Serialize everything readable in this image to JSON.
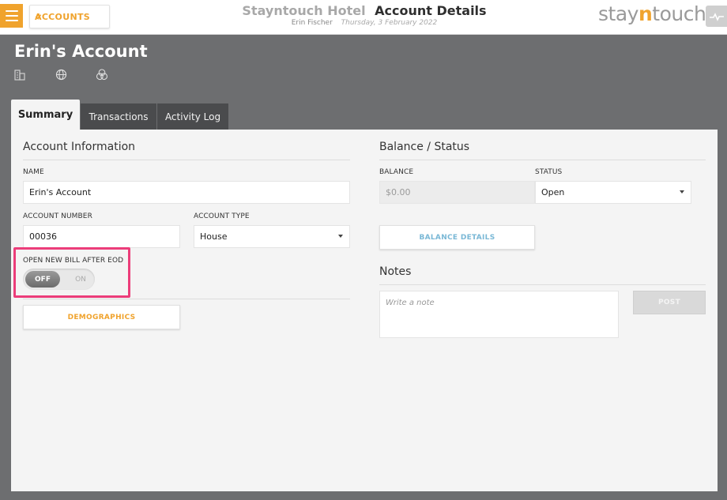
{
  "topbar": {
    "back_label": "ACCOUNTS",
    "hotel_name": "Stayntouch Hotel",
    "page_title": "Account Details",
    "user_name": "Erin Fischer",
    "date": "Thursday, 3 February 2022",
    "logo": {
      "prefix": "stay",
      "accent": "n",
      "suffix": "touch"
    }
  },
  "account": {
    "title": "Erin's Account",
    "icons": [
      "building-icon",
      "globe-icon",
      "venn-circles-icon"
    ]
  },
  "tabs": [
    {
      "label": "Summary",
      "active": true
    },
    {
      "label": "Transactions",
      "active": false
    },
    {
      "label": "Activity Log",
      "active": false
    }
  ],
  "account_info": {
    "section_title": "Account Information",
    "name_label": "NAME",
    "name_value": "Erin's Account",
    "number_label": "ACCOUNT NUMBER",
    "number_value": "00036",
    "type_label": "ACCOUNT TYPE",
    "type_value": "House",
    "open_bill_label": "OPEN NEW BILL AFTER EOD",
    "toggle_off": "OFF",
    "toggle_on": "ON",
    "toggle_state": "off",
    "demographics_button": "DEMOGRAPHICS"
  },
  "balance_status": {
    "section_title": "Balance / Status",
    "balance_label": "BALANCE",
    "balance_value": "$0.00",
    "status_label": "STATUS",
    "status_value": "Open",
    "details_button": "BALANCE DETAILS"
  },
  "notes": {
    "section_title": "Notes",
    "placeholder": "Write a note",
    "post_button": "POST"
  },
  "colors": {
    "accent": "#f0a32d",
    "link_blue": "#7ab8d6",
    "highlight": "#ec3d7a",
    "background": "#6d6e70"
  }
}
